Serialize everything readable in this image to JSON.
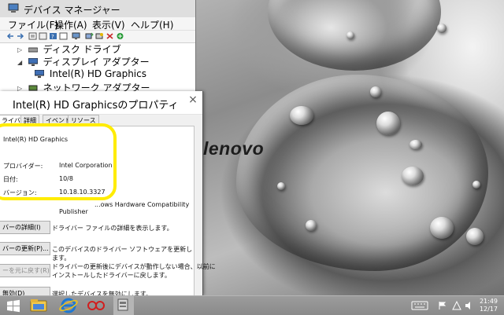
{
  "desktop": {
    "brand": "lenovo"
  },
  "device_manager": {
    "title": "デバイス マネージャー",
    "menu": [
      "ファイル(F)",
      "操作(A)",
      "表示(V)",
      "ヘルプ(H)"
    ],
    "tree": [
      {
        "label": "ディスク ドライブ",
        "icon": "disk-drive-icon",
        "expanded": false
      },
      {
        "label": "ディスプレイ アダプター",
        "icon": "display-adapter-icon",
        "expanded": true
      },
      {
        "label": "Intel(R) HD Graphics",
        "icon": "display-device-icon",
        "child": true
      },
      {
        "label": "ネットワーク アダプター",
        "icon": "network-adapter-icon",
        "expanded": false
      }
    ]
  },
  "properties": {
    "title": "Intel(R) HD Graphicsのプロパティ",
    "tabs": [
      "ライバー",
      "詳細",
      "イベント",
      "リソース"
    ],
    "device_name": "Intel(R) HD Graphics",
    "fields": [
      {
        "label": "プロバイダー:",
        "value": "Intel Corporation"
      },
      {
        "label": "日付:",
        "value": "10/8"
      },
      {
        "label": "バージョン:",
        "value": "10.18.10.3327"
      }
    ],
    "signer_partial": "...ows Hardware Compatibility",
    "signer_line2": "Publisher",
    "buttons": [
      {
        "label": "バーの詳細(I)",
        "desc": "ドライバー ファイルの詳細を表示します。",
        "enabled": true
      },
      {
        "label": "バーの更新(P)...",
        "desc": "このデバイスのドライバー ソフトウェアを更新します。",
        "enabled": true
      },
      {
        "label": "ーを元に戻す(R)",
        "desc": "ドライバーの更新後にデバイスが動作しない場合、以前に\nインストールしたドライバーに戻します。",
        "enabled": false
      },
      {
        "label": "無効(D)",
        "desc": "選択したデバイスを無効にします。",
        "enabled": true
      }
    ]
  },
  "taskbar": {
    "time": "21:49",
    "date": "12/17",
    "apps": [
      "start-button",
      "explorer-icon",
      "internet-explorer-icon",
      "lenovo-app-icon",
      "device-manager-icon"
    ],
    "tray": [
      "keyboard-icon",
      "flag-icon",
      "network-icon",
      "volume-icon"
    ]
  },
  "colors": {
    "highlight": "#ffec00",
    "ie_blue": "#1e78d2",
    "app_red": "#d21e1e"
  }
}
